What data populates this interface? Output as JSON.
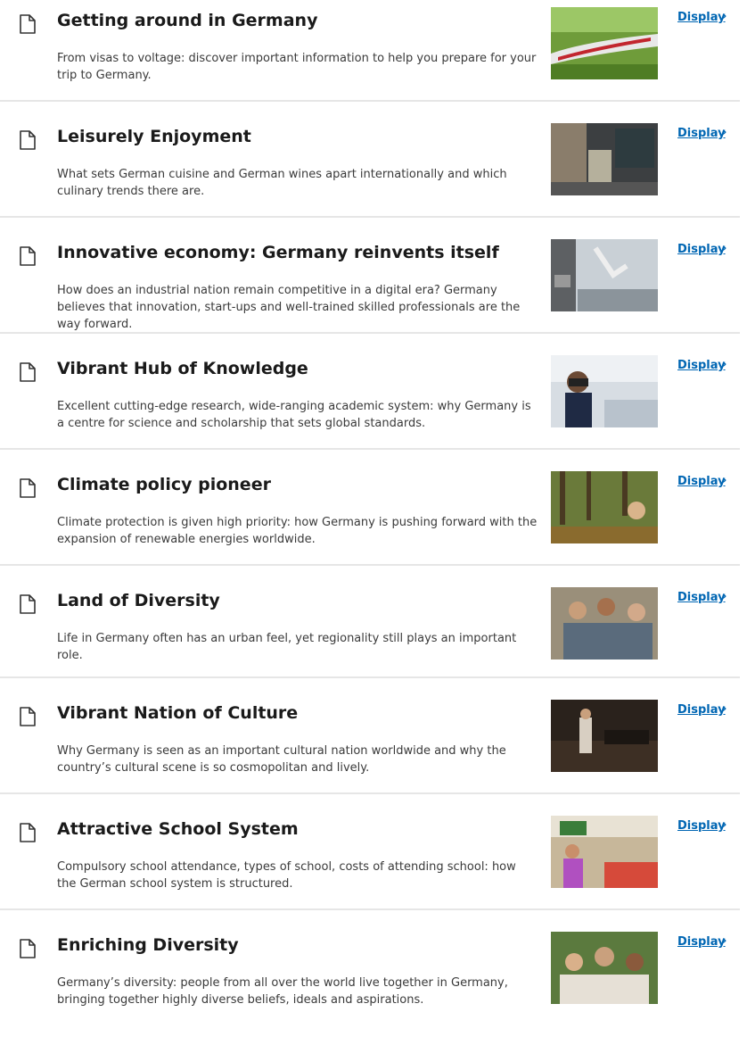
{
  "display_label": "Display",
  "chevron": "›",
  "items": [
    {
      "title": "Getting around in Germany",
      "description": "From visas to voltage: discover important information to help you prepare for your trip to Germany.",
      "icon": "document-icon",
      "image": "train-landscape-image"
    },
    {
      "title": "Leisurely Enjoyment",
      "description": "What sets German cuisine and German wines apart internationally and which culinary trends there are.",
      "icon": "document-icon",
      "image": "cafe-interior-image"
    },
    {
      "title": "Innovative economy: Germany reinvents itself",
      "description": "How does an industrial nation remain competitive in a digital era? Germany believes that innovation, start-ups and well-trained skilled professionals are the way forward.",
      "icon": "document-icon",
      "image": "robot-factory-image"
    },
    {
      "title": "Vibrant Hub of Knowledge",
      "description": "Excellent cutting-edge research, wide-ranging academic system: why Germany is a centre for science and scholarship that sets global standards.",
      "icon": "document-icon",
      "image": "vr-headset-lab-image"
    },
    {
      "title": "Climate policy pioneer",
      "description": "Climate protection is given high priority: how Germany is pushing forward with the expansion of renewable energies worldwide.",
      "icon": "document-icon",
      "image": "forest-group-image"
    },
    {
      "title": "Land of Diversity",
      "description": "Life in Germany often has an urban feel, yet regionality still plays an important role.",
      "icon": "document-icon",
      "image": "friends-laughing-image"
    },
    {
      "title": "Vibrant Nation of Culture",
      "description": "Why Germany is seen as an important cultural nation worldwide and why the country’s cultural scene is so cosmopolitan and lively.",
      "icon": "document-icon",
      "image": "orchestra-stage-image"
    },
    {
      "title": "Attractive School System",
      "description": "Compulsory school attendance, types of school, costs of attending school: how the German school system is structured.",
      "icon": "document-icon",
      "image": "classroom-image"
    },
    {
      "title": "Enriching Diversity",
      "description": "Germany’s diversity: people from all over the world live together in Germany, bringing together highly diverse beliefs, ideals and aspirations.",
      "icon": "document-icon",
      "image": "people-group-image"
    }
  ]
}
